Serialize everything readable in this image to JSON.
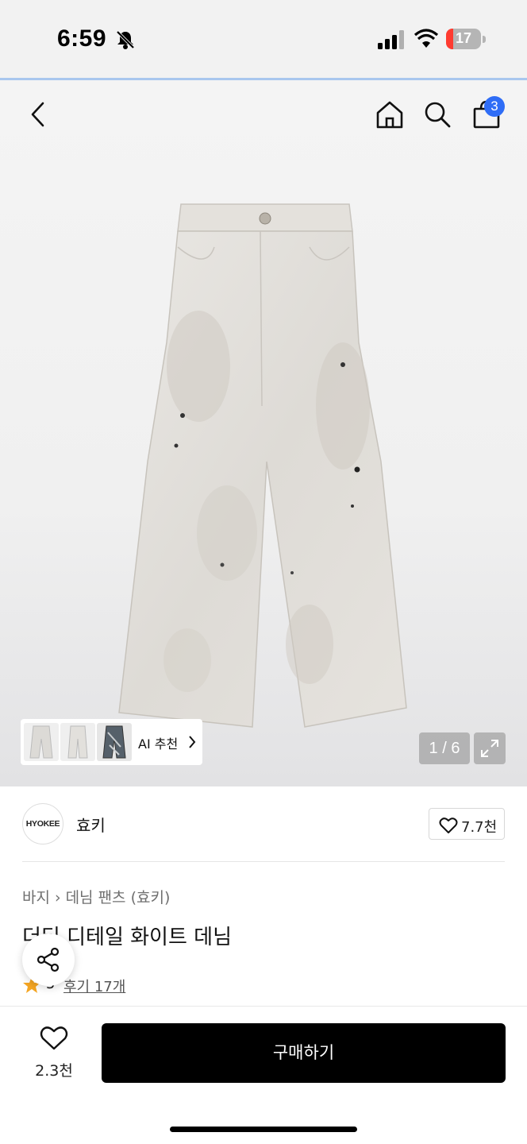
{
  "status_bar": {
    "time": "6:59",
    "battery_level": "17",
    "icons": [
      "bell-slash-icon",
      "cellular-signal-icon",
      "wifi-icon",
      "battery-icon"
    ]
  },
  "header": {
    "icons": [
      "back-arrow-icon",
      "home-icon",
      "search-icon",
      "shopping-bag-icon"
    ],
    "cart_count": "3"
  },
  "gallery": {
    "ai_label": "AI 추천",
    "page_indicator": "1 / 6",
    "thumbnails": [
      "white-jeans-thumb",
      "white-jeans-thumb-2",
      "dark-jeans-thumb"
    ]
  },
  "brand": {
    "logo_text": "HYOKEE",
    "name": "효키",
    "like_count": "7.7천"
  },
  "product": {
    "breadcrumb": [
      "바지",
      "데님 팬츠 (효키)"
    ],
    "title": "더티 디테일 화이트 데님",
    "rating": "5",
    "review_link": "후기 17개"
  },
  "bottom_bar": {
    "wish_count": "2.3천",
    "buy_label": "구매하기"
  },
  "colors": {
    "accent": "#2f6df6",
    "buy_button": "#000000",
    "star": "#f5a623",
    "battery_low": "#ff3b30"
  }
}
